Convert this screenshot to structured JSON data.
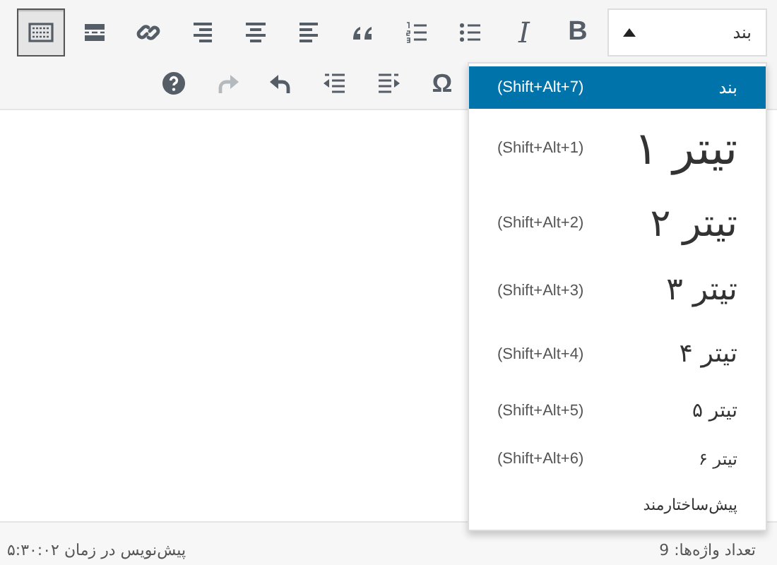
{
  "format_select": {
    "value": "بند",
    "expanded": true
  },
  "toolbar_row_1": [
    {
      "kind": "bold",
      "glyph": "B",
      "selected": false
    },
    {
      "kind": "italic",
      "glyph": "I",
      "selected": false
    },
    {
      "kind": "ul",
      "selected": false
    },
    {
      "kind": "ol",
      "selected": false
    },
    {
      "kind": "quote",
      "selected": false
    },
    {
      "kind": "alignleft",
      "selected": false
    },
    {
      "kind": "aligncenter",
      "selected": false
    },
    {
      "kind": "alignright",
      "selected": false
    },
    {
      "kind": "link",
      "selected": false
    },
    {
      "kind": "more",
      "selected": false
    },
    {
      "kind": "kitchensink",
      "selected": true
    }
  ],
  "toolbar_row_2": [
    {
      "kind": "omega",
      "glyph": "Ω",
      "disabled": false
    },
    {
      "kind": "indent",
      "disabled": false
    },
    {
      "kind": "outdent",
      "disabled": false
    },
    {
      "kind": "undo",
      "disabled": false
    },
    {
      "kind": "redo",
      "disabled": true
    },
    {
      "kind": "help",
      "disabled": false
    }
  ],
  "format_menu": [
    {
      "kind": "p",
      "label": "بند",
      "shortcut": "(Shift+Alt+7)",
      "selected": true
    },
    {
      "kind": "h1",
      "label": "تیتر ۱",
      "shortcut": "(Shift+Alt+1)",
      "selected": false
    },
    {
      "kind": "h2",
      "label": "تیتر ۲",
      "shortcut": "(Shift+Alt+2)",
      "selected": false
    },
    {
      "kind": "h3",
      "label": "تیتر ۳",
      "shortcut": "(Shift+Alt+3)",
      "selected": false
    },
    {
      "kind": "h4",
      "label": "تیتر ۴",
      "shortcut": "(Shift+Alt+4)",
      "selected": false
    },
    {
      "kind": "h5",
      "label": "تیتر ۵",
      "shortcut": "(Shift+Alt+5)",
      "selected": false
    },
    {
      "kind": "h6",
      "label": "تیتر ۶",
      "shortcut": "(Shift+Alt+6)",
      "selected": false
    },
    {
      "kind": "pre",
      "label": "پیش‌ساختارمند",
      "selected": false
    }
  ],
  "status_bar": {
    "draft_saved": "پیش‌نویس در زمان ۵:۳۰:۰۲",
    "word_count": "تعداد واژه‌ها: 9"
  }
}
